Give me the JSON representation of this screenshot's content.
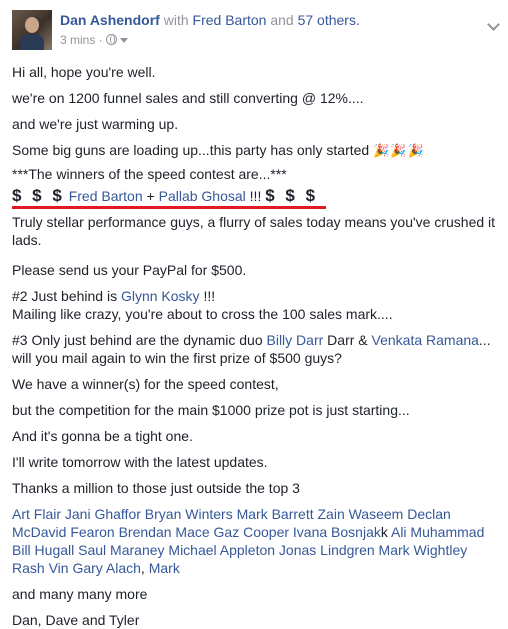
{
  "post": {
    "author": "Dan Ashendorf",
    "with_word": "with",
    "tagged": "Fred Barton",
    "and_word": "and",
    "others": "57 others.",
    "time": "3 mins ·",
    "icons": {
      "avatar": "profile-photo",
      "privacy": "globe-icon",
      "menu": "chevron-down-icon"
    }
  },
  "content": {
    "l1": "Hi all, hope you're well.",
    "l2": "we're on 1200 funnel sales and still converting @ 12%....",
    "l3": "and we're just warming up.",
    "l4": "Some big guns are loading up...this party has only started",
    "l4_party": "🎉🎉🎉",
    "l5": "***The winners of the speed contest are...***",
    "l6_dollars_left": "$ $ $",
    "l6_name1": "Fred Barton",
    "l6_plus": "+",
    "l6_name2": "Pallab Ghosal",
    "l6_bang": "!!!",
    "l6_dollars_right": "$ $ $",
    "l7": "Truly stellar performance guys, a flurry of sales today means you've crushed it lads.",
    "l8": "Please send us your PayPal for $500.",
    "l9_a": "#2 Just behind is",
    "l9_name": "Glynn Kosky",
    "l9_b": "!!!",
    "l10": "Mailing like crazy, you're about to cross the 100 sales mark....",
    "l11_a": "#3 Only just behind are the dynamic duo",
    "l11_name1": "Billy Darr",
    "l11_b": "Darr &",
    "l11_name2": "Venkata Ramana",
    "l11_c": "...",
    "l12": "will you mail again to win the first prize of $500 guys?",
    "l13": "We have a winner(s) for the speed contest,",
    "l14": "but the competition for the main $1000 prize pot is just starting...",
    "l15": "And it's gonna be a tight one.",
    "l16": "I'll write tomorrow with the latest updates.",
    "l17": "Thanks a million to those just outside the top 3",
    "names_1": "Art Flair Jani Ghaffor Bryan Winters Mark Barrett Zain Waseem Declan",
    "names_2a": "McDavid Fearon Brendan Mace Gaz Cooper Ivana Bosnjak",
    "names_2b": "k",
    "names_2c": "Ali Muhammad",
    "names_3": "Bill Hugall Saul Maraney Michael Appleton Jonas Lindgren Mark Wightley",
    "names_4a": "Rash Vin Gary Alach",
    "names_4b": ",",
    "names_4c": "Mark",
    "l18": "and many many more",
    "l19": "Dan, Dave and Tyler"
  },
  "colors": {
    "link": "#365899",
    "text": "#1d2129",
    "muted": "#90949c",
    "underline": "#e01b24"
  }
}
